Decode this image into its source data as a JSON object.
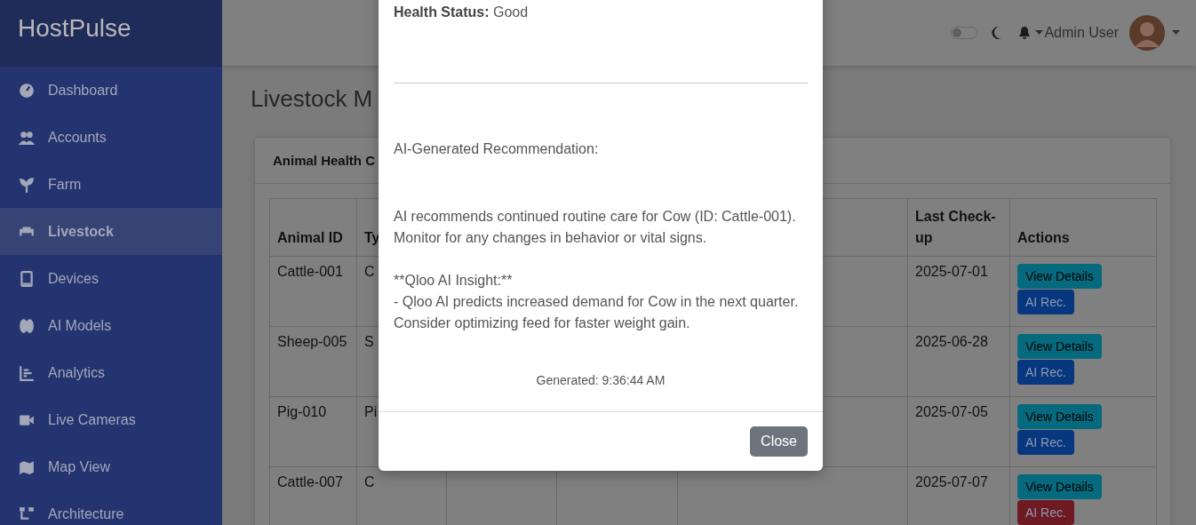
{
  "brand": "HostPulse",
  "sidebar": {
    "items": [
      {
        "label": "Dashboard",
        "selected": false
      },
      {
        "label": "Accounts",
        "selected": false
      },
      {
        "label": "Farm",
        "selected": false
      },
      {
        "label": "Livestock",
        "selected": true
      },
      {
        "label": "Devices",
        "selected": false
      },
      {
        "label": "AI Models",
        "selected": false
      },
      {
        "label": "Analytics",
        "selected": false
      },
      {
        "label": "Live Cameras",
        "selected": false
      },
      {
        "label": "Map View",
        "selected": false
      },
      {
        "label": "Architecture",
        "selected": false
      }
    ]
  },
  "header": {
    "dark_mode": {
      "on": false
    },
    "user_name": "Admin User"
  },
  "page_title": "Livestock M",
  "card": {
    "title": "Animal Health C",
    "table": {
      "columns": [
        "Animal ID",
        "Ty",
        "",
        "",
        "",
        "Last Check-up",
        "Actions"
      ],
      "rows": [
        {
          "animal_id": "Cattle-001",
          "type": "C",
          "last_checkup": "2025-07-01",
          "view_button": "View Details",
          "ai_button": {
            "label": "AI Rec.",
            "color": "#06377f"
          }
        },
        {
          "animal_id": "Sheep-005",
          "type": "S",
          "last_checkup": "2025-06-28",
          "view_button": "View Details",
          "ai_button": {
            "label": "AI Rec.",
            "color": "#06377f"
          }
        },
        {
          "animal_id": "Pig-010",
          "type": "Pi",
          "last_checkup": "2025-07-05",
          "view_button": "View Details",
          "ai_button": {
            "label": "AI Rec.",
            "color": "#06377f"
          }
        },
        {
          "animal_id": "Cattle-007",
          "type": "C",
          "last_checkup": "2025-07-07",
          "view_button": "View Details",
          "ai_button": {
            "label": "AI Rec.",
            "color": "#6e1a23"
          }
        }
      ]
    }
  },
  "modal": {
    "health_status": "**Health Status:** Good",
    "recommendation_heading": "AI-Generated Recommendation:",
    "recommendation": [
      "AI recommends continued routine care for Cow (ID: Cattle-001).",
      "Monitor for any changes in behavior or vital signs."
    ],
    "insight": [
      "**Qloo AI Insight:**",
      "- Qloo AI predicts increased demand for Cow in the next quarter.",
      "Consider optimizing feed for faster weight gain."
    ],
    "generated": "Generated: 9:36:44 AM",
    "close_button": "Close"
  }
}
